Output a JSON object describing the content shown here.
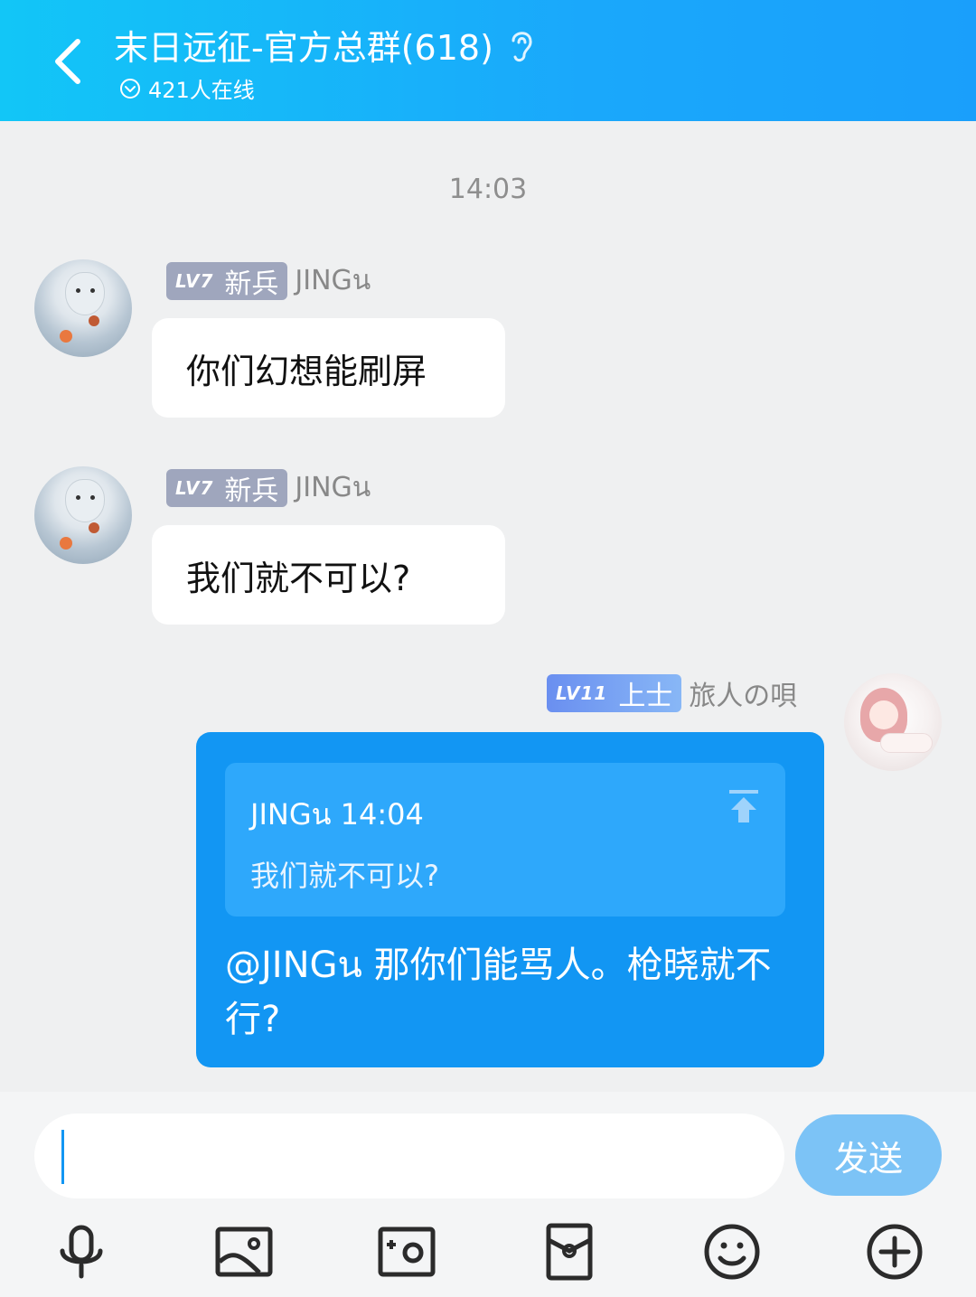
{
  "header": {
    "title": "末日远征-官方总群(618)",
    "online": "421人在线"
  },
  "chat": {
    "timestamp": "14:03",
    "messages": [
      {
        "level": "LV7",
        "rank": "新兵",
        "name": "JINGน",
        "text": "你们幻想能刷屏"
      },
      {
        "level": "LV7",
        "rank": "新兵",
        "name": "JINGน",
        "text": "我们就不可以?"
      }
    ],
    "my_message": {
      "level": "LV11",
      "rank": "上士",
      "name": "旅人の唄",
      "quote_header": "JINGน 14:04",
      "quote_text": "我们就不可以?",
      "reply_text": "@JINGน 那你们能骂人。枪晓就不行?"
    }
  },
  "input": {
    "placeholder": "",
    "send_label": "发送"
  },
  "toolbar": {
    "icons": [
      "microphone-icon",
      "image-icon",
      "camera-icon",
      "red-packet-icon",
      "emoji-icon",
      "plus-icon"
    ]
  },
  "colors": {
    "header_start": "#12c6f7",
    "header_end": "#1a9ffb",
    "my_bubble": "#1296f3",
    "send_button": "#7cc3f6",
    "badge_grey": "#9fa6bd"
  }
}
